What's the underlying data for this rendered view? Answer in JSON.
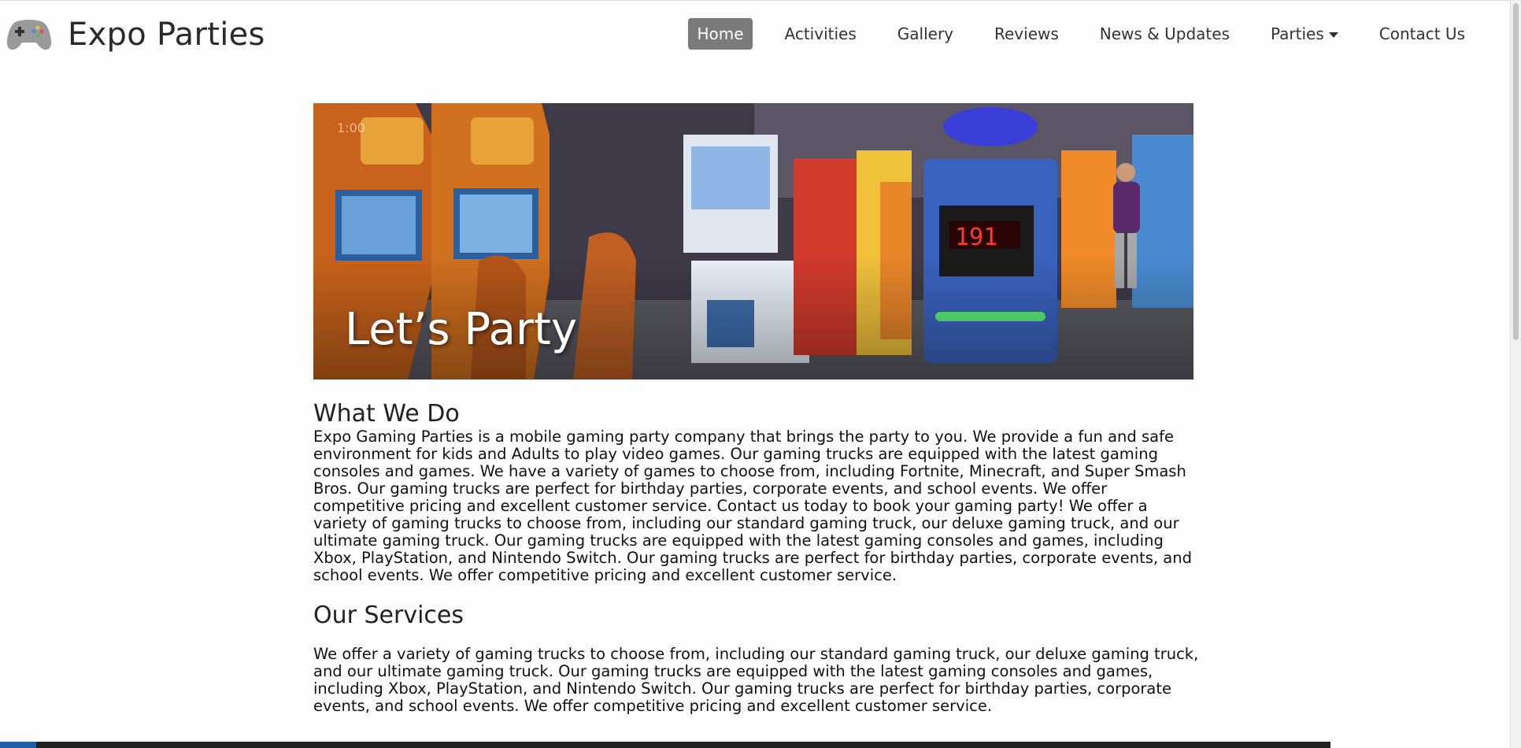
{
  "header": {
    "brand": "Expo Parties",
    "logo_icon": "gamepad-icon",
    "nav": [
      {
        "label": "Home",
        "active": true
      },
      {
        "label": "Activities",
        "active": false
      },
      {
        "label": "Gallery",
        "active": false
      },
      {
        "label": "Reviews",
        "active": false
      },
      {
        "label": "News & Updates",
        "active": false
      },
      {
        "label": "Parties",
        "active": false,
        "dropdown": true
      },
      {
        "label": "Contact Us",
        "active": false
      }
    ]
  },
  "hero": {
    "title": "Let’s Party",
    "time": "1:00"
  },
  "sections": [
    {
      "heading": "What We Do",
      "text": "Expo Gaming Parties is a mobile gaming party company that brings the party to you. We provide a fun and safe environment for kids and Adults to play video games. Our gaming trucks are equipped with the latest gaming consoles and games. We have a variety of games to choose from, including Fortnite, Minecraft, and Super Smash Bros. Our gaming trucks are perfect for birthday parties, corporate events, and school events. We offer competitive pricing and excellent customer service. Contact us today to book your gaming party! We offer a variety of gaming trucks to choose from, including our standard gaming truck, our deluxe gaming truck, and our ultimate gaming truck. Our gaming trucks are equipped with the latest gaming consoles and games, including Xbox, PlayStation, and Nintendo Switch. Our gaming trucks are perfect for birthday parties, corporate events, and school events. We offer competitive pricing and excellent customer service."
    },
    {
      "heading": "Our Services",
      "text": "We offer a variety of gaming trucks to choose from, including our standard gaming truck, our deluxe gaming truck, and our ultimate gaming truck. Our gaming trucks are equipped with the latest gaming consoles and games, including Xbox, PlayStation, and Nintendo Switch. Our gaming trucks are perfect for birthday parties, corporate events, and school events. We offer competitive pricing and excellent customer service."
    }
  ],
  "colors": {
    "nav_active_bg": "#7a7a7a",
    "text": "#222222"
  }
}
